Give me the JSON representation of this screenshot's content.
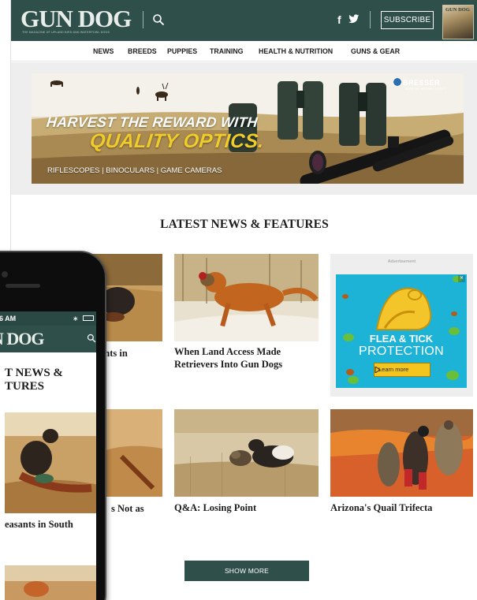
{
  "site": {
    "brand": "GUN DOG",
    "tagline": "THE MAGAZINE OF UPLAND BIRD AND WATERFOWL DOGS",
    "social": {
      "facebook": "f",
      "twitter": "🐦"
    },
    "subscribe_label": "SUBSCRIBE",
    "magazine_cover_title": "GUN DOG"
  },
  "nav": [
    "NEWS",
    "BREEDS",
    "PUPPIES",
    "TRAINING",
    "HEALTH & NUTRITION",
    "GUNS & GEAR"
  ],
  "banner_ad": {
    "headline_line1": "HARVEST THE REWARD WITH",
    "headline_line2": "QUALITY OPTICS.",
    "subline": "RIFLESCOPES | BINOCULARS | GAME CAMERAS",
    "brand": "BRESSER",
    "brand_tagline": "SINCE 1957 BRESSER OPTICS"
  },
  "section_title": "LATEST NEWS & FEATURES",
  "cards": [
    {
      "title": "ants in"
    },
    {
      "title": "When Land Access Made Retrievers Into Gun Dogs"
    },
    {
      "title": "s Not as"
    },
    {
      "title": "Q&A: Losing Point"
    },
    {
      "title": "Arizona's Quail Trifecta"
    }
  ],
  "side_ad": {
    "label": "Advertisement",
    "line1": "FLEA & TICK",
    "line2": "PROTECTION",
    "cta": "Learn more",
    "close": "✕"
  },
  "show_more_label": "SHOW MORE",
  "phone": {
    "time": "26 AM",
    "brand": "N DOG",
    "section_title_line1": "T NEWS &",
    "section_title_line2": "TURES",
    "caption": "easants in South"
  },
  "colors": {
    "brand_green": "#2f4f4b",
    "ad_cyan": "#1db3d6",
    "ad_yellow": "#f3c51d"
  }
}
